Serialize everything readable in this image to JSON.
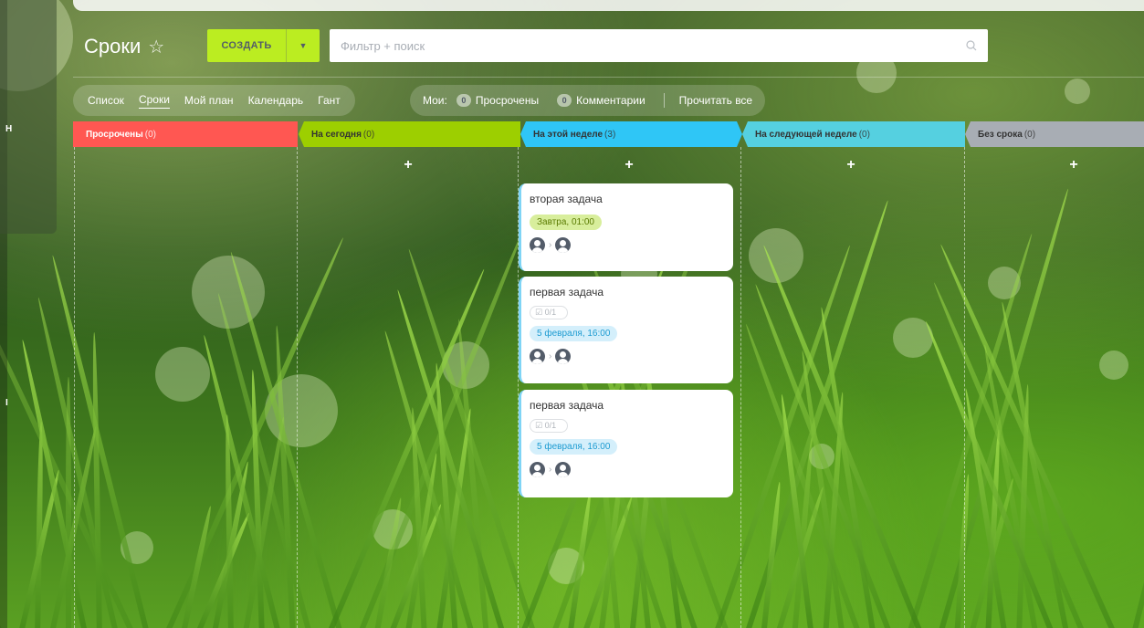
{
  "page": {
    "title": "Сроки"
  },
  "toolbar": {
    "create_label": "СОЗДАТЬ"
  },
  "search": {
    "placeholder": "Фильтр + поиск"
  },
  "views": [
    {
      "label": "Список",
      "active": false
    },
    {
      "label": "Сроки",
      "active": true
    },
    {
      "label": "Мой план",
      "active": false
    },
    {
      "label": "Календарь",
      "active": false
    },
    {
      "label": "Гант",
      "active": false
    }
  ],
  "counters": {
    "label": "Мои:",
    "overdue": {
      "count": "0",
      "label": "Просрочены"
    },
    "comments": {
      "count": "0",
      "label": "Комментарии"
    },
    "read_all": "Прочитать все"
  },
  "left_panel": {
    "letters": [
      "Н",
      "І"
    ]
  },
  "columns": [
    {
      "title": "Просрочены",
      "count": "(0)",
      "color": "#ff5752",
      "text_color": "#ffffff"
    },
    {
      "title": "На сегодня",
      "count": "(0)",
      "color": "#9dcf00",
      "text_color": "#333333"
    },
    {
      "title": "На этой неделе",
      "count": "(3)",
      "color": "#2fc6f6",
      "text_color": "#333333"
    },
    {
      "title": "На следующей неделе",
      "count": "(0)",
      "color": "#55d0e0",
      "text_color": "#333333"
    },
    {
      "title": "Без срока",
      "count": "(0)",
      "color": "#a8adb4",
      "text_color": "#333333"
    }
  ],
  "add_symbol": "+",
  "cards": [
    {
      "title": "вторая задача",
      "checklist": "",
      "deadline": "Завтра, 01:00",
      "deadline_style": "green"
    },
    {
      "title": "первая задача",
      "checklist": "0/1",
      "deadline": "5 февраля, 16:00",
      "deadline_style": "blue"
    },
    {
      "title": "первая задача",
      "checklist": "0/1",
      "deadline": "5 февраля, 16:00",
      "deadline_style": "blue"
    }
  ],
  "icons": {
    "star": "☆",
    "dropdown": "▼",
    "search": "○",
    "checklist": "☑",
    "arrow": "›"
  }
}
